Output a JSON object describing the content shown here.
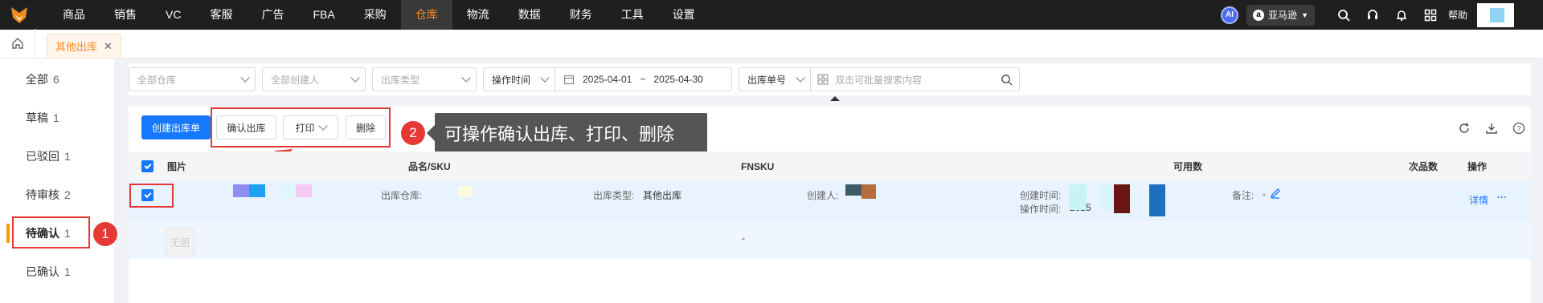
{
  "topnav": {
    "items": [
      "商品",
      "销售",
      "VC",
      "客服",
      "广告",
      "FBA",
      "采购",
      "仓库",
      "物流",
      "数据",
      "财务",
      "工具",
      "设置"
    ],
    "active": "仓库",
    "ai_label": "AI",
    "marketplace": "亚马逊",
    "help": "帮助"
  },
  "tabs": {
    "page_tab": "其他出库"
  },
  "sidebar": {
    "items": [
      {
        "label": "全部",
        "count": "6"
      },
      {
        "label": "草稿",
        "count": "1"
      },
      {
        "label": "已驳回",
        "count": "1"
      },
      {
        "label": "待审核",
        "count": "2"
      },
      {
        "label": "待确认",
        "count": "1"
      },
      {
        "label": "已确认",
        "count": "1"
      }
    ],
    "active": "待确认"
  },
  "filters": {
    "warehouse": "全部仓库",
    "creator": "全部创建人",
    "outbound_type": "出库类型",
    "time_type": "操作时间",
    "date_start": "2025-04-01",
    "date_sep": "~",
    "date_end": "2025-04-30",
    "search_field": "出库单号",
    "search_placeholder": "双击可批量搜索内容"
  },
  "toolbar": {
    "create": "创建出库单",
    "confirm": "确认出库",
    "print": "打印",
    "delete": "删除"
  },
  "annotations": {
    "badge1": "1",
    "badge2": "2",
    "tooltip": "可操作确认出库、打印、删除"
  },
  "table": {
    "headers": {
      "image": "图片",
      "name_sku": "品名/SKU",
      "fnsku": "FNSKU",
      "available": "可用数",
      "defective": "次品数",
      "action": "操作"
    },
    "row": {
      "warehouse_label": "出库仓库:",
      "type_label": "出库类型:",
      "type_value": "其他出库",
      "creator_label": "创建人:",
      "created_label": "创建时间:",
      "operated_label": "操作时间:",
      "operated_value": "2025",
      "remark_label": "备注:",
      "remark_value": "-",
      "detail": "详情",
      "more": "···"
    },
    "item": {
      "no_image": "无图",
      "fnsku": "-"
    }
  },
  "colors": {
    "brand_orange": "#ff8a1e",
    "primary_blue": "#1677ff",
    "annotation_red": "#e53935",
    "topbar": "#1f1f1f"
  }
}
